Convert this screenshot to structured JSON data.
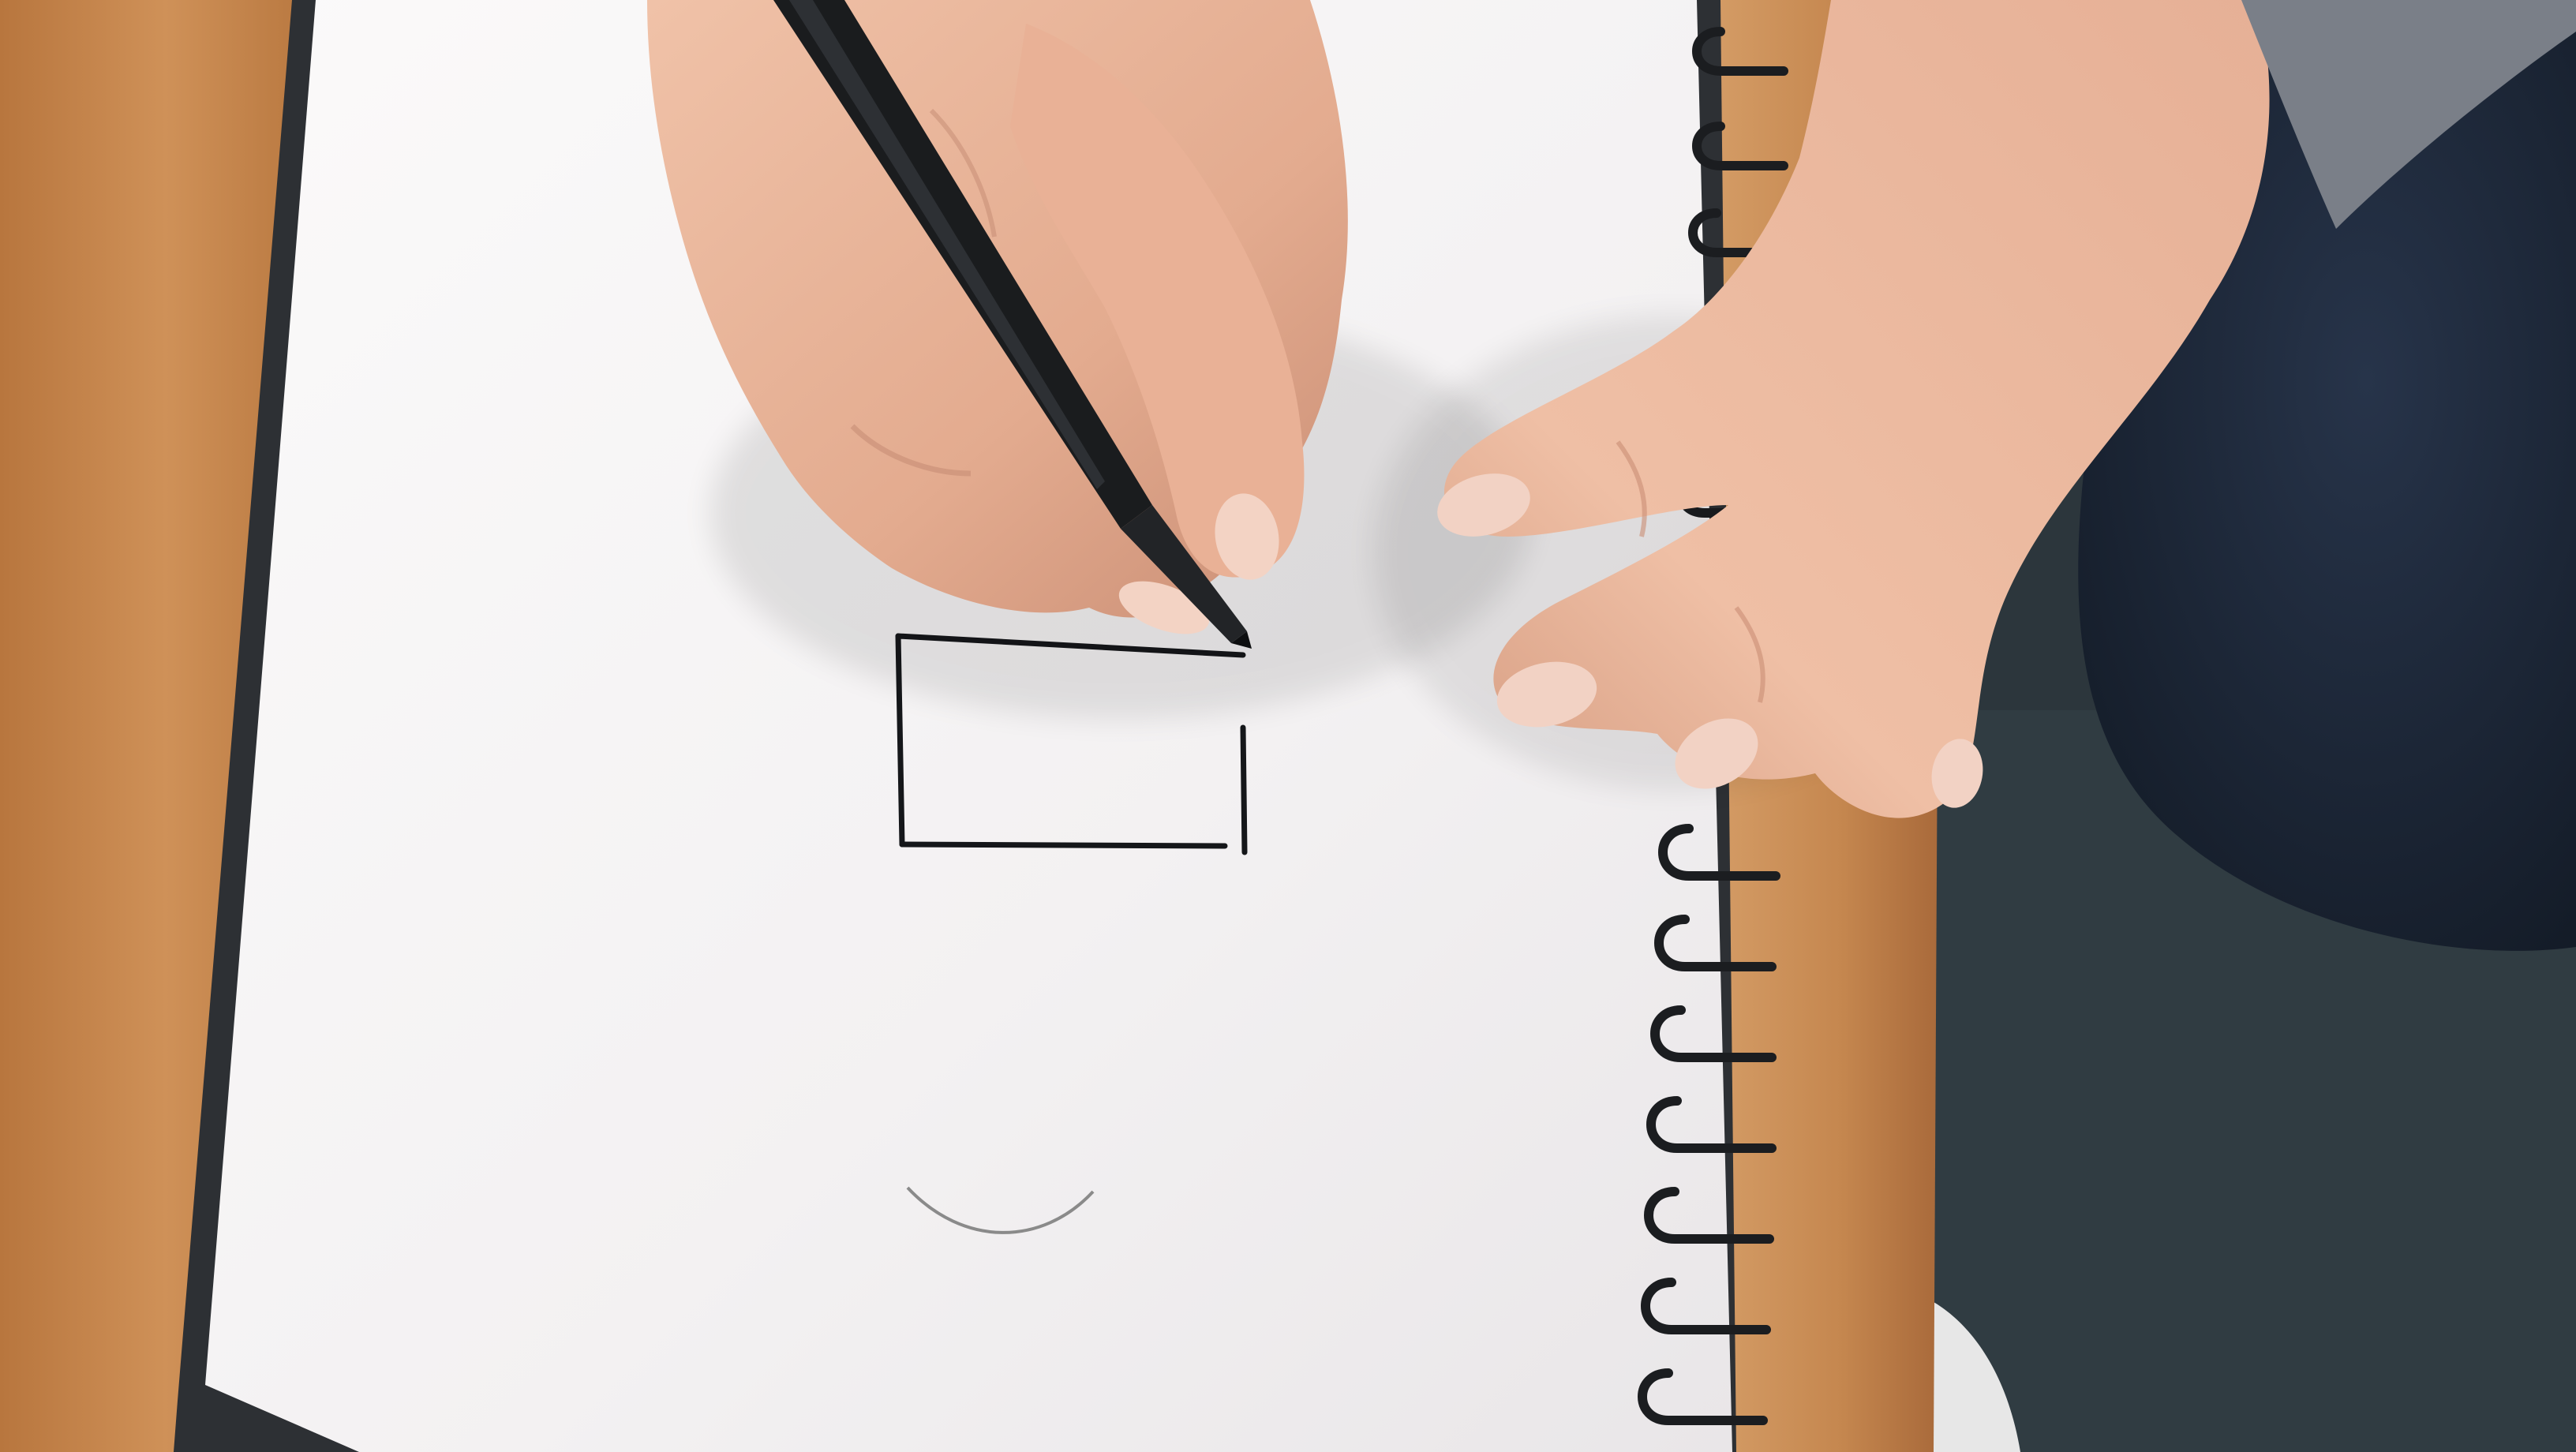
{
  "scene": {
    "caption": "",
    "palette": {
      "desk_wood": "#c98a4e",
      "desk_wood_dark": "#a96a34",
      "carpet": "#2f3a40",
      "jeans": "#1f2b3c",
      "sleeve": "#7a7f88",
      "sketchbook_cover": "#2c2f33",
      "paper": "#f4f2f2",
      "spiral": "#1b1d20",
      "skin": "#e8b49a",
      "skin_shadow": "#c98d74",
      "pen": "#1a1c1e",
      "ink": "#15171a",
      "pencil_arc": "#8a8a8a"
    },
    "drawing": {
      "shape": "unfinished rectangle",
      "pencil_mark": "arc"
    },
    "spiral_rings_visible": 13
  }
}
